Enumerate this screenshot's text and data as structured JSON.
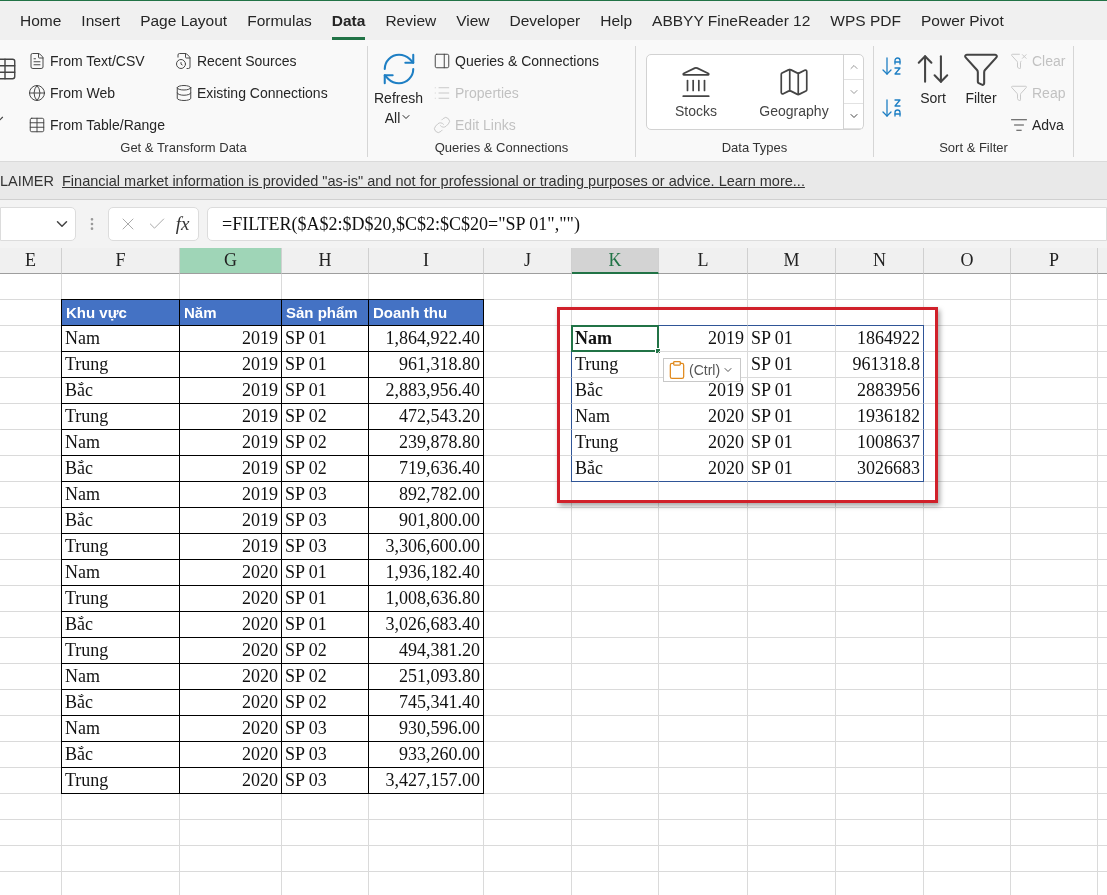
{
  "ribbon_tabs": [
    {
      "label": "Home",
      "selected": false
    },
    {
      "label": "Insert",
      "selected": false
    },
    {
      "label": "Page Layout",
      "selected": false
    },
    {
      "label": "Formulas",
      "selected": false
    },
    {
      "label": "Data",
      "selected": true
    },
    {
      "label": "Review",
      "selected": false
    },
    {
      "label": "View",
      "selected": false
    },
    {
      "label": "Developer",
      "selected": false
    },
    {
      "label": "Help",
      "selected": false
    },
    {
      "label": "ABBYY FineReader 12",
      "selected": false
    },
    {
      "label": "WPS PDF",
      "selected": false
    },
    {
      "label": "Power Pivot",
      "selected": false
    }
  ],
  "ribbon": {
    "groups": [
      {
        "label": "Get & Transform Data",
        "columns": [
          [
            {
              "kind": "stub",
              "dropdown": true
            }
          ],
          [
            {
              "kind": "small",
              "label": "From Text/CSV",
              "disabled": false
            },
            {
              "kind": "small",
              "label": "From Web",
              "disabled": false
            },
            {
              "kind": "small",
              "label": "From Table/Range",
              "disabled": false
            }
          ],
          [
            {
              "kind": "small",
              "label": "Recent Sources",
              "disabled": false
            },
            {
              "kind": "small",
              "label": "Existing Connections",
              "disabled": false
            }
          ]
        ]
      },
      {
        "label": "Queries & Connections",
        "columns": [
          [
            {
              "kind": "large",
              "label": "Refresh",
              "label2": "All",
              "disabled": false,
              "dropdown": true
            }
          ],
          [
            {
              "kind": "small",
              "label": "Queries & Connections",
              "disabled": false
            },
            {
              "kind": "small",
              "label": "Properties",
              "disabled": true
            },
            {
              "kind": "small",
              "label": "Edit Links",
              "disabled": true
            }
          ]
        ]
      },
      {
        "label": "Data Types",
        "columns": [
          [
            {
              "kind": "gallery",
              "tiles": [
                "Stocks",
                "Geography"
              ]
            }
          ]
        ]
      },
      {
        "label": "Sort & Filter",
        "columns": [
          [
            {
              "kind": "sort",
              "disabled": false
            },
            {
              "kind": "sort",
              "disabled": false
            }
          ],
          [
            {
              "kind": "large",
              "label": "Sort",
              "disabled": false,
              "dropdown": false
            }
          ],
          [
            {
              "kind": "large",
              "label": "Filter",
              "disabled": false,
              "dropdown": false
            }
          ],
          [
            {
              "kind": "small",
              "label": "Clear",
              "disabled": true
            },
            {
              "kind": "small",
              "label": "Reap",
              "disabled": true
            },
            {
              "kind": "small",
              "label": "Adva",
              "disabled": false
            }
          ]
        ]
      }
    ]
  },
  "disclaimer": {
    "label": "LAIMER",
    "link": "Financial market information is provided \"as-is\" and not for professional or trading purposes or advice. Learn more..."
  },
  "formula_bar": {
    "fx": "fx",
    "formula": "=FILTER($A$2:$D$20,$C$2:$C$20=\"SP 01\",\"\")"
  },
  "sheet": {
    "columns": [
      {
        "label": "E",
        "selected": false,
        "highlighted": false
      },
      {
        "label": "F",
        "selected": false,
        "highlighted": false
      },
      {
        "label": "G",
        "selected": false,
        "highlighted": true
      },
      {
        "label": "H",
        "selected": false,
        "highlighted": false
      },
      {
        "label": "I",
        "selected": false,
        "highlighted": false
      },
      {
        "label": "J",
        "selected": false,
        "highlighted": false
      },
      {
        "label": "K",
        "selected": true,
        "highlighted": false
      },
      {
        "label": "L",
        "selected": false,
        "highlighted": false
      },
      {
        "label": "M",
        "selected": false,
        "highlighted": false
      },
      {
        "label": "N",
        "selected": false,
        "highlighted": false
      },
      {
        "label": "O",
        "selected": false,
        "highlighted": false
      },
      {
        "label": "P",
        "selected": false,
        "highlighted": false
      }
    ],
    "source_table": {
      "columns": [
        "Khu vực",
        "Năm",
        "Sản phẩm",
        "Doanh thu"
      ],
      "rows": [
        [
          "Nam",
          "2019",
          "SP 01",
          "1,864,922.40"
        ],
        [
          "Trung",
          "2019",
          "SP 01",
          "961,318.80"
        ],
        [
          "Bắc",
          "2019",
          "SP 01",
          "2,883,956.40"
        ],
        [
          "Trung",
          "2019",
          "SP 02",
          "472,543.20"
        ],
        [
          "Nam",
          "2019",
          "SP 02",
          "239,878.80"
        ],
        [
          "Bắc",
          "2019",
          "SP 02",
          "719,636.40"
        ],
        [
          "Nam",
          "2019",
          "SP 03",
          "892,782.00"
        ],
        [
          "Bắc",
          "2019",
          "SP 03",
          "901,800.00"
        ],
        [
          "Trung",
          "2019",
          "SP 03",
          "3,306,600.00"
        ],
        [
          "Nam",
          "2020",
          "SP 01",
          "1,936,182.40"
        ],
        [
          "Trung",
          "2020",
          "SP 01",
          "1,008,636.80"
        ],
        [
          "Bắc",
          "2020",
          "SP 01",
          "3,026,683.40"
        ],
        [
          "Trung",
          "2020",
          "SP 02",
          "494,381.20"
        ],
        [
          "Nam",
          "2020",
          "SP 02",
          "251,093.80"
        ],
        [
          "Bắc",
          "2020",
          "SP 02",
          "745,341.40"
        ],
        [
          "Nam",
          "2020",
          "SP 03",
          "930,596.00"
        ],
        [
          "Bắc",
          "2020",
          "SP 03",
          "933,260.00"
        ],
        [
          "Trung",
          "2020",
          "SP 03",
          "3,427,157.00"
        ]
      ]
    },
    "filter_result": {
      "rows": [
        {
          "region": "Nam",
          "year": "2019",
          "product": "SP 01",
          "revenue": "1864922",
          "selected": true
        },
        {
          "region": "Trung",
          "product": "SP 01",
          "revenue": "961318.8",
          "selected": false
        },
        {
          "region": "Bắc",
          "year": "2019",
          "product": "SP 01",
          "revenue": "2883956",
          "selected": false
        },
        {
          "region": "Nam",
          "year": "2020",
          "product": "SP 01",
          "revenue": "1936182",
          "selected": false
        },
        {
          "region": "Trung",
          "year": "2020",
          "product": "SP 01",
          "revenue": "1008637",
          "selected": false
        },
        {
          "region": "Bắc",
          "year": "2020",
          "product": "SP 01",
          "revenue": "3026683",
          "selected": false
        }
      ]
    },
    "paste_options": {
      "label": "(Ctrl)"
    }
  }
}
